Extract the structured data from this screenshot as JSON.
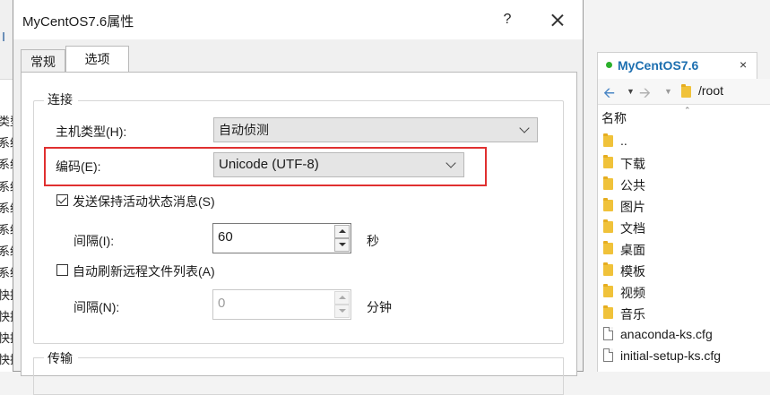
{
  "background_app": {
    "rows": [
      "类型",
      "系统",
      "系统",
      "系统",
      "系统",
      "系统",
      "系统",
      "系统",
      "快捷",
      "快捷",
      "快捷",
      "快捷"
    ]
  },
  "dialog": {
    "title": "MyCentOS7.6属性",
    "help_glyph": "?",
    "tabs": [
      {
        "label": "常规",
        "active": false
      },
      {
        "label": "选项",
        "active": true
      }
    ],
    "connection_group": {
      "title": "连接",
      "host_type_label": "主机类型(H):",
      "host_type_value": "自动侦测",
      "encoding_label": "编码(E):",
      "encoding_value": "Unicode (UTF-8)",
      "keepalive_label": "发送保持活动状态消息(S)",
      "keepalive_checked": true,
      "keepalive_interval_label": "间隔(I):",
      "keepalive_interval_value": "60",
      "keepalive_unit": "秒",
      "auto_refresh_label": "自动刷新远程文件列表(A)",
      "auto_refresh_checked": false,
      "refresh_interval_label": "间隔(N):",
      "refresh_interval_value": "0",
      "refresh_unit": "分钟"
    },
    "transfer_group": {
      "title": "传输"
    },
    "highlight_color": "#e03030"
  },
  "file_pane": {
    "tab_title": "MyCentOS7.6",
    "tab_close": "×",
    "connected_color": "#2bb02b",
    "path": "/root",
    "column_header": "名称",
    "items": [
      {
        "name": "..",
        "type": "folder"
      },
      {
        "name": "下载",
        "type": "folder"
      },
      {
        "name": "公共",
        "type": "folder"
      },
      {
        "name": "图片",
        "type": "folder"
      },
      {
        "name": "文档",
        "type": "folder"
      },
      {
        "name": "桌面",
        "type": "folder"
      },
      {
        "name": "模板",
        "type": "folder"
      },
      {
        "name": "视频",
        "type": "folder"
      },
      {
        "name": "音乐",
        "type": "folder"
      },
      {
        "name": "anaconda-ks.cfg",
        "type": "file"
      },
      {
        "name": "initial-setup-ks.cfg",
        "type": "file"
      }
    ]
  }
}
